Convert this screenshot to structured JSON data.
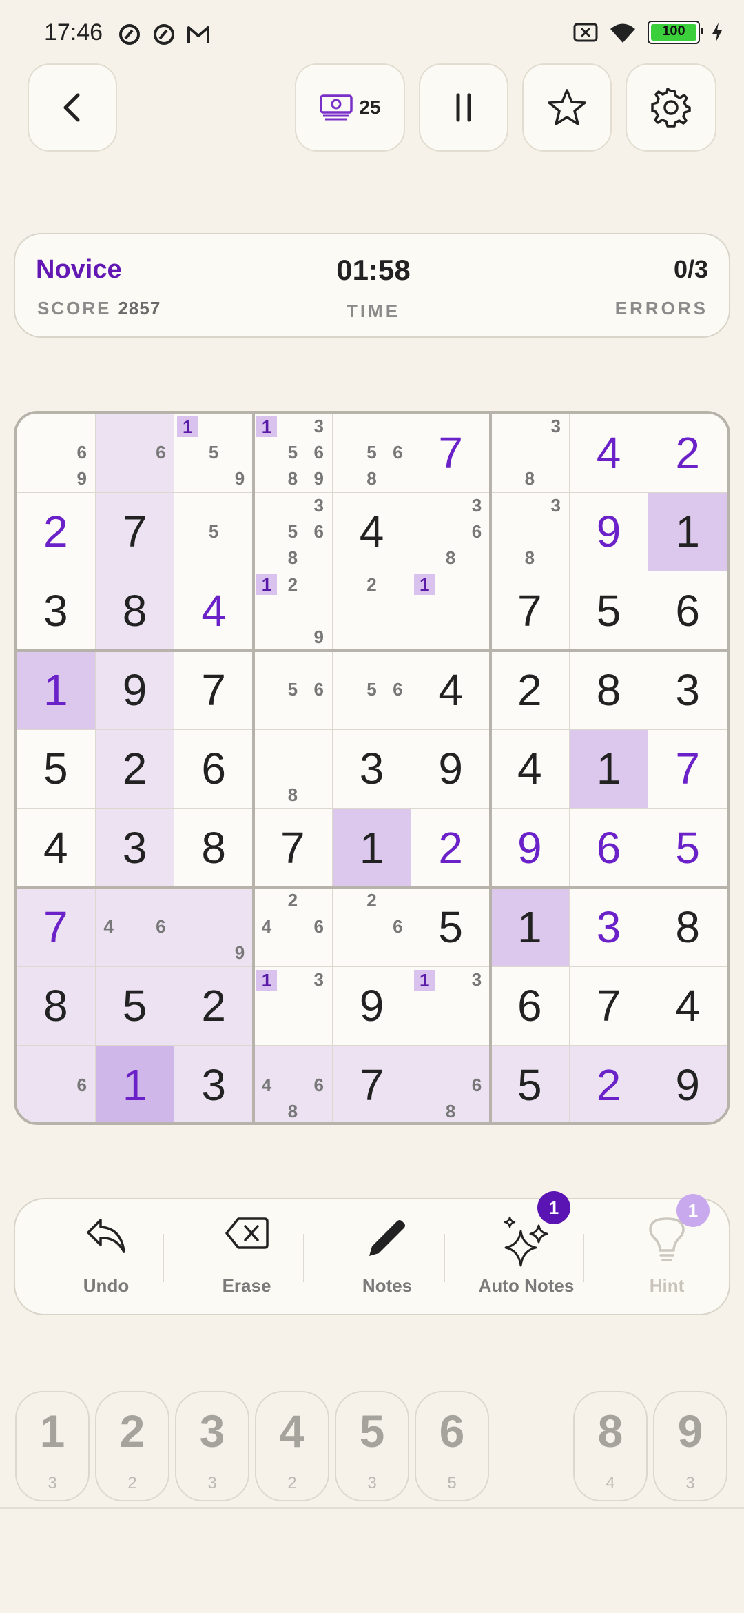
{
  "status_bar": {
    "time": "17:46",
    "battery_level": "100",
    "left_icons": [
      "app-notification-icon",
      "app-notification-icon",
      "gmail-icon"
    ],
    "right_icons": [
      "no-sim-icon",
      "wifi-icon",
      "battery-icon",
      "charging-icon"
    ]
  },
  "header": {
    "back_icon": "chevron-left-icon",
    "coins": "25",
    "pause_icon": "pause-icon",
    "favorite_icon": "star-icon",
    "settings_icon": "gear-icon"
  },
  "info": {
    "difficulty": "Novice",
    "score_label": "SCORE",
    "score_value": "2857",
    "timer": "01:58",
    "time_label": "TIME",
    "errors": "0/3",
    "errors_label": "ERRORS"
  },
  "board": {
    "rows": [
      [
        {
          "n": [
            6,
            9
          ]
        },
        {
          "n": [
            6
          ]
        },
        {
          "n": [
            1,
            5,
            9
          ],
          "h": 1
        },
        {
          "n": [
            1,
            3,
            5,
            6,
            8,
            9
          ],
          "h": 1
        },
        {
          "n": [
            5,
            6,
            8
          ]
        },
        {
          "v": 7,
          "u": 1
        },
        {
          "n": [
            3,
            8
          ]
        },
        {
          "v": 4,
          "u": 1
        },
        {
          "v": 2,
          "u": 1
        }
      ],
      [
        {
          "v": 2,
          "u": 1
        },
        {
          "v": 7
        },
        {
          "n": [
            5
          ]
        },
        {
          "n": [
            3,
            5,
            6,
            8
          ]
        },
        {
          "v": 4
        },
        {
          "n": [
            3,
            6,
            8
          ]
        },
        {
          "n": [
            3,
            8
          ]
        },
        {
          "v": 9,
          "u": 1
        },
        {
          "v": 1
        }
      ],
      [
        {
          "v": 3
        },
        {
          "v": 8
        },
        {
          "v": 4,
          "u": 1
        },
        {
          "n": [
            1,
            2,
            9
          ],
          "h": 1
        },
        {
          "n": [
            2
          ]
        },
        {
          "n": [
            1
          ],
          "h": 1
        },
        {
          "v": 7
        },
        {
          "v": 5
        },
        {
          "v": 6
        }
      ],
      [
        {
          "v": 1,
          "u": 1
        },
        {
          "v": 9
        },
        {
          "v": 7
        },
        {
          "n": [
            5,
            6
          ]
        },
        {
          "n": [
            5,
            6
          ]
        },
        {
          "v": 4
        },
        {
          "v": 2
        },
        {
          "v": 8
        },
        {
          "v": 3
        }
      ],
      [
        {
          "v": 5
        },
        {
          "v": 2
        },
        {
          "v": 6
        },
        {
          "n": [
            8
          ]
        },
        {
          "v": 3
        },
        {
          "v": 9
        },
        {
          "v": 4
        },
        {
          "v": 1
        },
        {
          "v": 7,
          "u": 1
        }
      ],
      [
        {
          "v": 4
        },
        {
          "v": 3
        },
        {
          "v": 8
        },
        {
          "v": 7
        },
        {
          "v": 1
        },
        {
          "v": 2,
          "u": 1
        },
        {
          "v": 9,
          "u": 1
        },
        {
          "v": 6,
          "u": 1
        },
        {
          "v": 5,
          "u": 1
        }
      ],
      [
        {
          "v": 7,
          "u": 1
        },
        {
          "n": [
            4,
            6
          ]
        },
        {
          "n": [
            9
          ]
        },
        {
          "n": [
            2,
            4,
            6
          ]
        },
        {
          "n": [
            2,
            6
          ]
        },
        {
          "v": 5
        },
        {
          "v": 1
        },
        {
          "v": 3,
          "u": 1
        },
        {
          "v": 8
        }
      ],
      [
        {
          "v": 8
        },
        {
          "v": 5
        },
        {
          "v": 2
        },
        {
          "n": [
            1,
            3
          ],
          "h": 1
        },
        {
          "v": 9
        },
        {
          "n": [
            1,
            3
          ],
          "h": 1
        },
        {
          "v": 6
        },
        {
          "v": 7
        },
        {
          "v": 4
        }
      ],
      [
        {
          "n": [
            6
          ]
        },
        {
          "v": 1,
          "u": 1
        },
        {
          "v": 3
        },
        {
          "n": [
            4,
            6,
            8
          ]
        },
        {
          "v": 7
        },
        {
          "n": [
            6,
            8
          ]
        },
        {
          "v": 5
        },
        {
          "v": 2,
          "u": 1
        },
        {
          "v": 9
        }
      ]
    ],
    "colors": {
      "selected": "#d0b7ea",
      "same_number": "#dcc8ec",
      "related": "#ece2f2",
      "base": "#fcfbf7",
      "user_digit": "#6b21c8",
      "given_digit": "#222222"
    },
    "selected_cell": [
      8,
      1
    ],
    "highlighted_number": 1
  },
  "toolbar": {
    "undo": "Undo",
    "erase": "Erase",
    "notes": "Notes",
    "auto_notes": "Auto Notes",
    "auto_notes_badge": "1",
    "hint": "Hint",
    "hint_badge": "1"
  },
  "numpad": [
    {
      "digit": "1",
      "count": "3"
    },
    {
      "digit": "2",
      "count": "2"
    },
    {
      "digit": "3",
      "count": "3"
    },
    {
      "digit": "4",
      "count": "2"
    },
    {
      "digit": "5",
      "count": "3"
    },
    {
      "digit": "6",
      "count": "5"
    },
    {
      "digit": "8",
      "count": "4"
    },
    {
      "digit": "9",
      "count": "3"
    }
  ]
}
